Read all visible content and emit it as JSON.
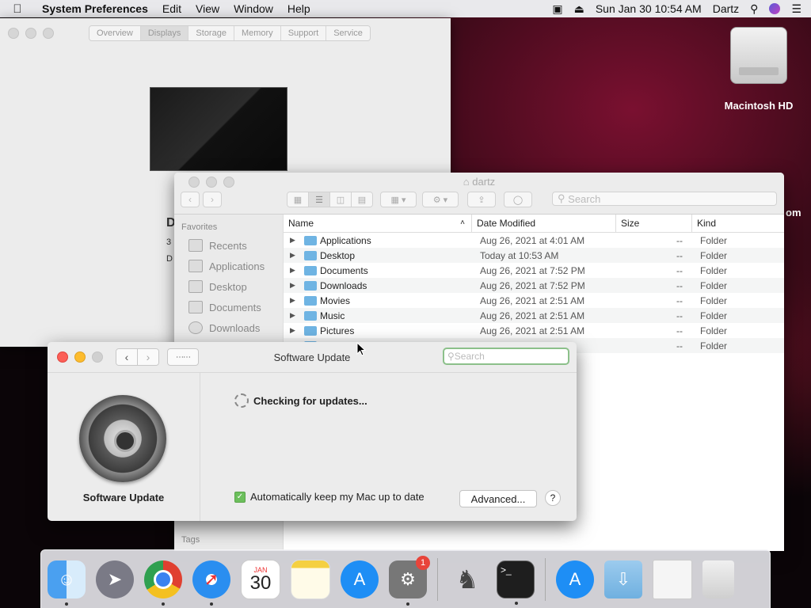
{
  "menubar": {
    "app": "System Preferences",
    "menus": [
      "Edit",
      "View",
      "Window",
      "Help"
    ],
    "datetime": "Sun Jan 30  10:54 AM",
    "user": "Dartz"
  },
  "desktop": {
    "hd_label": "Macintosh HD",
    "partial_label": "om"
  },
  "sysprefs": {
    "tabs": [
      "Overview",
      "Displays",
      "Storage",
      "Memory",
      "Support",
      "Service"
    ],
    "partial_text": [
      "D",
      "3",
      "D"
    ]
  },
  "finder": {
    "title": "dartz",
    "search_placeholder": "Search",
    "sidebar_header": "Favorites",
    "sidebar_items": [
      "Recents",
      "Applications",
      "Desktop",
      "Documents",
      "Downloads"
    ],
    "tags_label": "Tags",
    "columns": {
      "name": "Name",
      "date": "Date Modified",
      "size": "Size",
      "kind": "Kind"
    },
    "rows": [
      {
        "name": "Applications",
        "date": "Aug 26, 2021 at 4:01 AM",
        "size": "--",
        "kind": "Folder"
      },
      {
        "name": "Desktop",
        "date": "Today at 10:53 AM",
        "size": "--",
        "kind": "Folder"
      },
      {
        "name": "Documents",
        "date": "Aug 26, 2021 at 7:52 PM",
        "size": "--",
        "kind": "Folder"
      },
      {
        "name": "Downloads",
        "date": "Aug 26, 2021 at 7:52 PM",
        "size": "--",
        "kind": "Folder"
      },
      {
        "name": "Movies",
        "date": "Aug 26, 2021 at 2:51 AM",
        "size": "--",
        "kind": "Folder"
      },
      {
        "name": "Music",
        "date": "Aug 26, 2021 at 2:51 AM",
        "size": "--",
        "kind": "Folder"
      },
      {
        "name": "Pictures",
        "date": "Aug 26, 2021 at 2:51 AM",
        "size": "--",
        "kind": "Folder"
      },
      {
        "name": "",
        "date": "AM",
        "size": "--",
        "kind": "Folder"
      }
    ]
  },
  "software_update": {
    "title": "Software Update",
    "search_placeholder": "Search",
    "pane_name": "Software Update",
    "status": "Checking for updates...",
    "auto_label": "Automatically keep my Mac up to date",
    "auto_checked": true,
    "advanced_label": "Advanced...",
    "help_label": "?"
  },
  "dock": {
    "calendar_month": "JAN",
    "calendar_day": "30",
    "sysprefs_badge": "1",
    "items": [
      "finder-icon",
      "launchpad-icon",
      "chrome-icon",
      "safari-icon",
      "calendar-icon",
      "notes-icon",
      "app-store-icon",
      "system-preferences-icon",
      "chess-icon",
      "terminal-icon",
      "app-store-folder-icon",
      "downloads-folder-icon",
      "chrome-document-icon",
      "trash-icon"
    ]
  }
}
